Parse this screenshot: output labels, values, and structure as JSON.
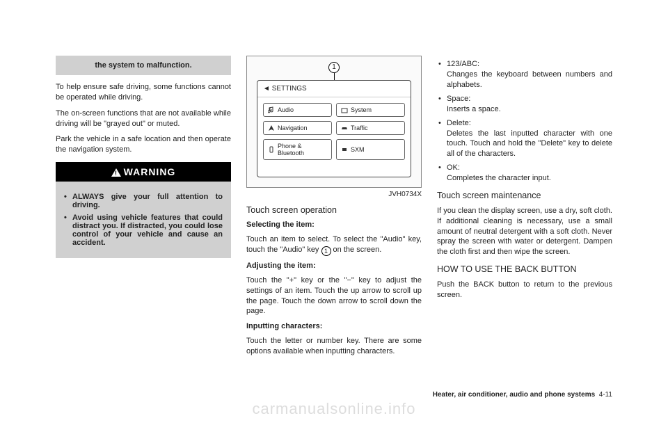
{
  "col1": {
    "grey_continue": "the system to malfunction.",
    "p1": "To help ensure safe driving, some functions cannot be operated while driving.",
    "p2": "The on-screen functions that are not available while driving will be \"grayed out\" or muted.",
    "p3": "Park the vehicle in a safe location and then operate the navigation system.",
    "warn_title": "WARNING",
    "warn_items": [
      "ALWAYS give your full attention to driving.",
      "Avoid using vehicle features that could distract you. If distracted, you could lose control of your vehicle and cause an accident."
    ]
  },
  "col2": {
    "figure": {
      "marker": "1",
      "title": "SETTINGS",
      "buttons": [
        "Audio",
        "System",
        "Navigation",
        "Traffic",
        "Phone & Bluetooth",
        "SXM"
      ],
      "caption": "JVH0734X"
    },
    "h_touch_op": "Touch screen operation",
    "sel_h": "Selecting the item:",
    "sel_p_a": "Touch an item to select. To select the \"Audio\" key, touch the \"Audio\" key ",
    "sel_p_b": " on the screen.",
    "sel_marker": "1",
    "adj_h": "Adjusting the item:",
    "adj_p": "Touch the \"+\" key or the \"−\" key to adjust the settings of an item. Touch the up arrow to scroll up the page. Touch the down arrow to scroll down the page.",
    "inp_h": "Inputting characters:",
    "inp_p": "Touch the letter or number key. There are some options available when inputting characters."
  },
  "col3": {
    "bullets": [
      {
        "lbl": "123/ABC:",
        "desc": "Changes the keyboard between numbers and alphabets."
      },
      {
        "lbl": "Space:",
        "desc": "Inserts a space."
      },
      {
        "lbl": "Delete:",
        "desc": "Deletes the last inputted character with one touch. Touch and hold the \"Delete\" key to delete all of the characters."
      },
      {
        "lbl": "OK:",
        "desc": "Completes the character input."
      }
    ],
    "h_maint": "Touch screen maintenance",
    "maint_p": "If you clean the display screen, use a dry, soft cloth. If additional cleaning is necessary, use a small amount of neutral detergent with a soft cloth. Never spray the screen with water or detergent. Dampen the cloth first and then wipe the screen.",
    "h_back": "HOW TO USE THE BACK BUTTON",
    "back_p": "Push the BACK button to return to the previous screen."
  },
  "footer": {
    "section": "Heater, air conditioner, audio and phone systems",
    "page": "4-11"
  },
  "watermark": "carmanualsonline.info"
}
